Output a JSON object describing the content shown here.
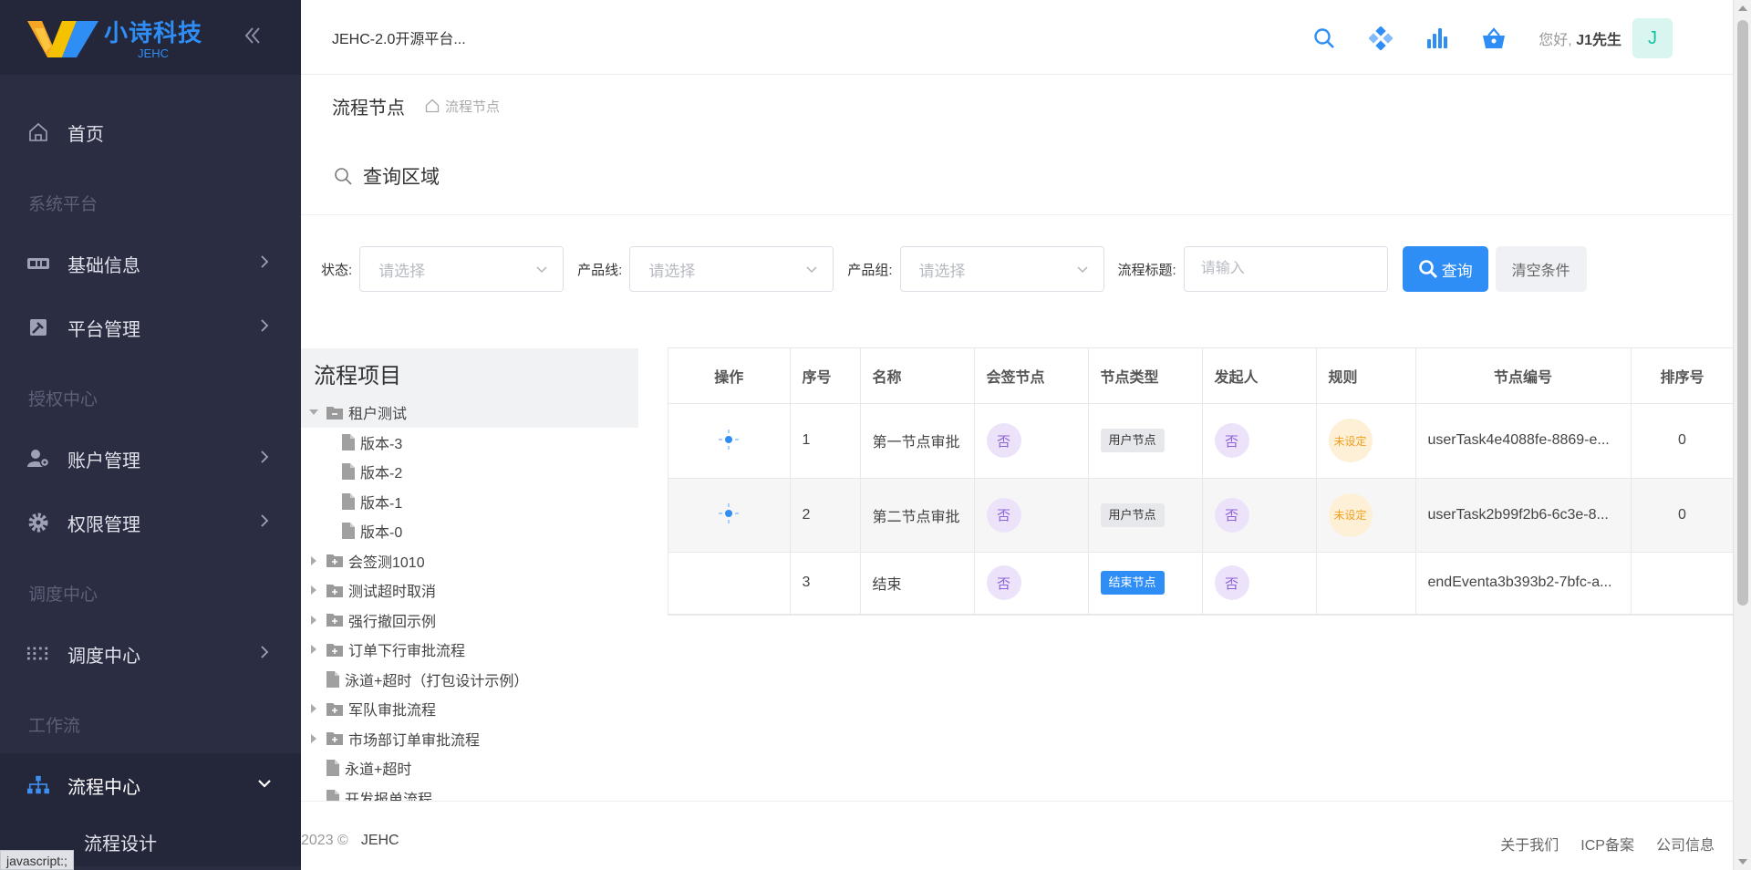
{
  "brand": {
    "name": "小诗科技",
    "sub": "JEHC"
  },
  "sidebar": {
    "home": "首页",
    "groups": [
      {
        "label": "系统平台",
        "items": [
          "基础信息",
          "平台管理"
        ]
      },
      {
        "label": "授权中心",
        "items": [
          "账户管理",
          "权限管理"
        ]
      },
      {
        "label": "调度中心",
        "items": [
          "调度中心"
        ]
      },
      {
        "label": "工作流",
        "items": [
          "流程中心"
        ]
      }
    ],
    "submenu": "流程设计",
    "status_url": "javascript:;"
  },
  "topbar": {
    "app_title": "JEHC-2.0开源平台...",
    "greeting": "您好,",
    "user": "J1先生",
    "avatar": "J",
    "icons": [
      "search-icon",
      "apps-icon",
      "chart-icon",
      "basket-icon"
    ]
  },
  "breadcrumb": {
    "title": "流程节点",
    "home": "流程节点"
  },
  "query": {
    "title": "查询区域",
    "filters": [
      {
        "label": "状态:",
        "placeholder": "请选择"
      },
      {
        "label": "产品线:",
        "placeholder": "请选择"
      },
      {
        "label": "产品组:",
        "placeholder": "请选择"
      }
    ],
    "title_filter": {
      "label": "流程标题:",
      "placeholder": "请输入"
    },
    "search_btn": "查询",
    "clear_btn": "清空条件"
  },
  "tree": {
    "title": "流程项目",
    "nodes": [
      {
        "label": "租户测试",
        "type": "folder-open",
        "level": 0,
        "selected": true
      },
      {
        "label": "版本-3",
        "type": "file",
        "level": 1
      },
      {
        "label": "版本-2",
        "type": "file",
        "level": 1
      },
      {
        "label": "版本-1",
        "type": "file",
        "level": 1
      },
      {
        "label": "版本-0",
        "type": "file",
        "level": 1
      },
      {
        "label": "会签测1010",
        "type": "folder",
        "level": 0
      },
      {
        "label": "测试超时取消",
        "type": "folder",
        "level": 0
      },
      {
        "label": "强行撤回示例",
        "type": "folder",
        "level": 0
      },
      {
        "label": "订单下行审批流程",
        "type": "folder",
        "level": 0
      },
      {
        "label": "泳道+超时（打包设计示例）",
        "type": "file",
        "level": 0
      },
      {
        "label": "军队审批流程",
        "type": "folder",
        "level": 0
      },
      {
        "label": "市场部订单审批流程",
        "type": "folder",
        "level": 0
      },
      {
        "label": "永道+超时",
        "type": "file",
        "level": 0
      },
      {
        "label": "开发报单流程",
        "type": "file",
        "level": 0
      }
    ]
  },
  "table": {
    "headers": [
      "操作",
      "序号",
      "名称",
      "会签节点",
      "节点类型",
      "发起人",
      "规则",
      "节点编号",
      "排序号"
    ],
    "rows": [
      {
        "op": true,
        "no": "1",
        "name": "第一节点审批",
        "sign": "否",
        "type": "用户节点",
        "type_color": "gray",
        "starter": "否",
        "rule": "未设定",
        "code": "userTask4e4088fe-8869-e...",
        "sort": "0"
      },
      {
        "op": true,
        "no": "2",
        "name": "第二节点审批",
        "sign": "否",
        "type": "用户节点",
        "type_color": "gray",
        "starter": "否",
        "rule": "未设定",
        "code": "userTask2b99f2b6-6c3e-8...",
        "sort": "0"
      },
      {
        "op": false,
        "no": "3",
        "name": "结束",
        "sign": "否",
        "type": "结束节点",
        "type_color": "blue",
        "starter": "否",
        "rule": "",
        "code": "endEventa3b393b2-7bfc-a...",
        "sort": ""
      }
    ]
  },
  "footer": {
    "copyright": "2023 ©",
    "brand": "JEHC",
    "links": [
      "关于我们",
      "ICP备案",
      "公司信息"
    ]
  },
  "colors": {
    "sidebar": "#2b2d42",
    "primary": "#2f8ef5",
    "purple": "#8e63d6",
    "warn": "#f0a020"
  }
}
